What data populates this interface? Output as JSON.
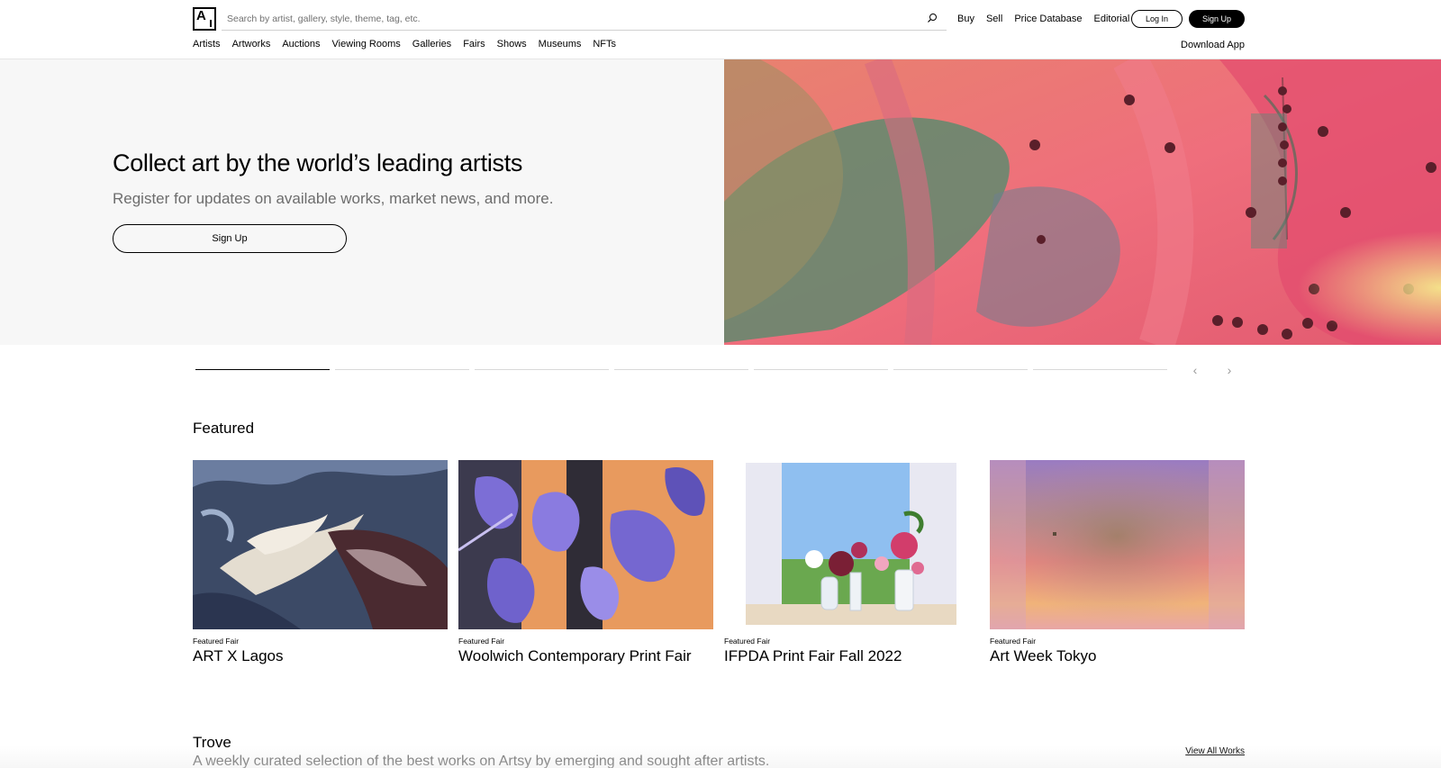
{
  "header": {
    "logo_text": "A",
    "search_placeholder": "Search by artist, gallery, style, theme, tag, etc.",
    "top_links": [
      "Buy",
      "Sell",
      "Price Database",
      "Editorial"
    ],
    "login_label": "Log In",
    "signup_label": "Sign Up",
    "nav_items": [
      "Artists",
      "Artworks",
      "Auctions",
      "Viewing Rooms",
      "Galleries",
      "Fairs",
      "Shows",
      "Museums",
      "NFTs"
    ],
    "download_app_label": "Download App"
  },
  "hero": {
    "title": "Collect art by the world’s leading artists",
    "subtitle": "Register for updates on available works, market news, and more.",
    "button_label": "Sign Up"
  },
  "carousel": {
    "segment_count": 7,
    "active_index": 0,
    "prev_icon": "chevron-left-icon",
    "next_icon": "chevron-right-icon"
  },
  "featured": {
    "title": "Featured",
    "cards": [
      {
        "kicker": "Featured Fair",
        "name": "ART X Lagos"
      },
      {
        "kicker": "Featured Fair",
        "name": "Woolwich Contemporary Print Fair"
      },
      {
        "kicker": "Featured Fair",
        "name": "IFPDA Print Fair Fall 2022"
      },
      {
        "kicker": "Featured Fair",
        "name": "Art Week Tokyo"
      }
    ]
  },
  "trove": {
    "title": "Trove",
    "subtitle": "A weekly curated selection of the best works on Artsy by emerging and sought after artists.",
    "view_all_label": "View All Works"
  },
  "colors": {
    "hero_bg": "#f7f7f7",
    "text_primary": "#000000",
    "text_secondary": "#6d6d6d",
    "button_dark": "#000000"
  }
}
